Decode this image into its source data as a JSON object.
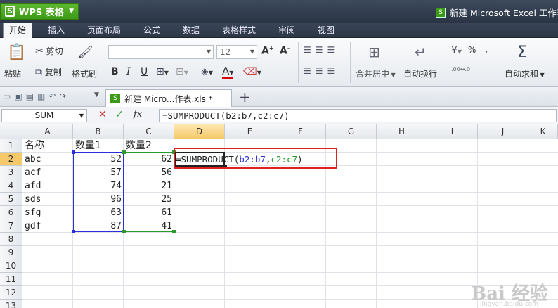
{
  "app": {
    "logo": "S",
    "name": "WPS 表格",
    "window_title": "新建 Microsoft Excel 工作表"
  },
  "menu": [
    "开始",
    "插入",
    "页面布局",
    "公式",
    "数据",
    "表格样式",
    "审阅",
    "视图"
  ],
  "ribbon": {
    "paste": "粘贴",
    "cut": "剪切",
    "copy": "复制",
    "format_painter": "格式刷",
    "font_size": "12",
    "merge_center": "合并居中",
    "wrap_text": "自动换行",
    "autosum": "自动求和",
    "percent": "%",
    "comma": ","
  },
  "doc_tab": {
    "label": "新建 Micro...作表.xls *",
    "add": "+"
  },
  "formula_bar": {
    "name_box": "SUM",
    "cancel": "✕",
    "confirm": "✓",
    "fx": "fx",
    "formula": "=SUMPRODUCT(b2:b7,c2:c7)"
  },
  "columns": [
    "A",
    "B",
    "C",
    "D",
    "E",
    "F",
    "G",
    "H",
    "I",
    "J",
    "K"
  ],
  "rows": [
    "1",
    "2",
    "3",
    "4",
    "5",
    "6",
    "7",
    "8",
    "9",
    "10",
    "11",
    "12",
    "13"
  ],
  "cells": {
    "header": [
      "名称",
      "数量1",
      "数量2"
    ],
    "names": [
      "abc",
      "acf",
      "afd",
      "sds",
      "sfg",
      "gdf"
    ],
    "qty1": [
      "52",
      "57",
      "74",
      "96",
      "63",
      "87"
    ],
    "qty2": [
      "62",
      "56",
      "21",
      "25",
      "61",
      "41"
    ]
  },
  "edit_cell": {
    "prefix": "=SUMPRODUCT(",
    "range1": "b2:b7",
    "comma": ",",
    "range2": "c2:c7",
    "suffix": ")"
  },
  "colors": {
    "range1": "#2a30d8",
    "range2": "#2a9a2a",
    "highlight": "#e02020"
  },
  "watermark": {
    "main": "Bai 经验",
    "sub": "jingyan.baidu.com"
  }
}
